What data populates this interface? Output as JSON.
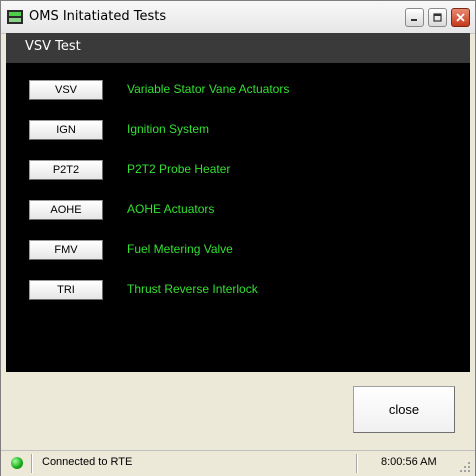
{
  "window": {
    "title": "OMS Initatiated Tests",
    "controls": {
      "minimize_icon": "minimize-icon",
      "maximize_icon": "maximize-icon",
      "close_icon": "close-icon"
    }
  },
  "header": {
    "title": "VSV Test"
  },
  "tests": [
    {
      "button": "VSV",
      "label": "Variable Stator Vane Actuators"
    },
    {
      "button": "IGN",
      "label": "Ignition System"
    },
    {
      "button": "P2T2",
      "label": "P2T2 Probe Heater"
    },
    {
      "button": "AOHE",
      "label": "AOHE Actuators"
    },
    {
      "button": "FMV",
      "label": "Fuel Metering Valve"
    },
    {
      "button": "TRI",
      "label": "Thrust Reverse Interlock"
    }
  ],
  "footer": {
    "close_label": "close"
  },
  "statusbar": {
    "connection": "Connected to RTE",
    "time": "8:00:56 AM",
    "connection_color": "#18a818"
  },
  "colors": {
    "label_green": "#33e033",
    "panel_bg": "#000000",
    "header_bg": "#3a3a3a"
  }
}
